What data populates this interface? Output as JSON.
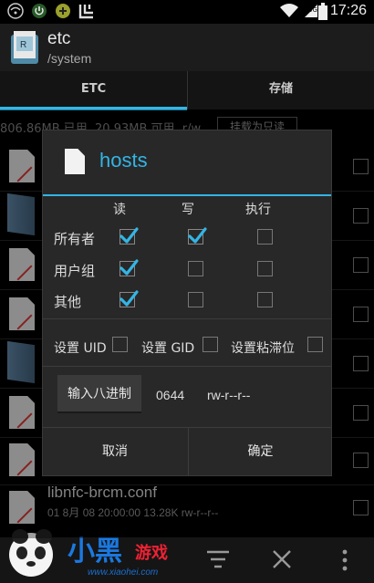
{
  "statusbar": {
    "time": "17:26"
  },
  "actionbar": {
    "title": "etc",
    "subtitle": "/system"
  },
  "tabs": [
    {
      "label": "ETC"
    },
    {
      "label": "存储"
    }
  ],
  "background": {
    "storage_info": "806.86MB 已用, 20.93MB 可用, r/w",
    "mount_button": "挂载为只读",
    "visible_file": {
      "name": "libnfc-brcm.conf",
      "meta": "01 8月 08 20:00:00  13.28K  rw-r--r--"
    }
  },
  "dialog": {
    "title": "hosts",
    "columns": [
      "读",
      "写",
      "执行"
    ],
    "rows": [
      {
        "label": "所有者",
        "checks": [
          true,
          true,
          false
        ]
      },
      {
        "label": "用户组",
        "checks": [
          true,
          false,
          false
        ]
      },
      {
        "label": "其他",
        "checks": [
          true,
          false,
          false
        ]
      }
    ],
    "options": [
      {
        "label": "设置 UID",
        "checked": false
      },
      {
        "label": "设置 GID",
        "checked": false
      },
      {
        "label": "设置粘滞位",
        "checked": false
      }
    ],
    "octal_button": "输入八进制",
    "octal_value": "0644",
    "permission_string": "rw-r--r--",
    "cancel": "取消",
    "ok": "确定"
  },
  "watermark": {
    "site": "www.xiaohei.com"
  },
  "colors": {
    "accent": "#33b5e5",
    "check": "#33b5e5"
  }
}
